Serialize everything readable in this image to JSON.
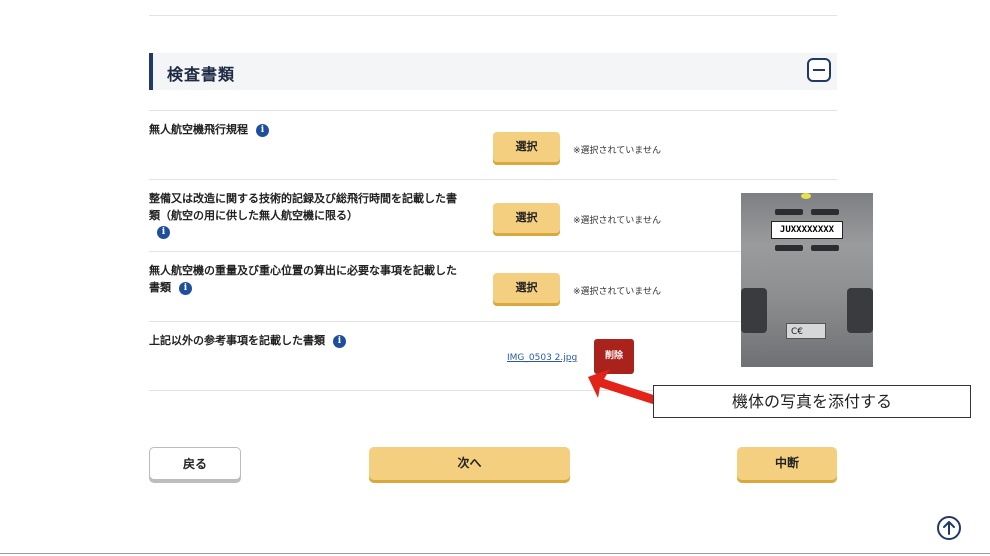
{
  "section": {
    "title": "検査書類",
    "collapse_icon": "minus-square-icon"
  },
  "rows": [
    {
      "label": "無人航空機飛行規程",
      "button_label": "選択",
      "status": "※選択されていません"
    },
    {
      "label": "整備又は改造に関する技術的記録及び総飛行時間を記載した書類（航空の用に供した無人航空機に限る）",
      "button_label": "選択",
      "status": "※選択されていません"
    },
    {
      "label": "無人航空機の重量及び重心位置の算出に必要な事項を記載した書類",
      "button_label": "選択",
      "status": "※選択されていません"
    },
    {
      "label": "上記以外の参考事項を記載した書類",
      "file_name": "IMG_0503 2.jpg",
      "delete_label": "削除"
    }
  ],
  "info_icon": {
    "glyph": "i",
    "name": "info-icon"
  },
  "photo": {
    "tag_text": "JUXXXXXXXX",
    "ce_text": "C€"
  },
  "callout": {
    "text": "機体の写真を添付する",
    "arrow_color": "#e2231a"
  },
  "footer": {
    "back_label": "戻る",
    "next_label": "次へ",
    "suspend_label": "中断"
  },
  "colors": {
    "accent_button": "#f5cf80",
    "delete_button": "#a9231c",
    "header_bar": "#1f3a66",
    "info_icon": "#1f4f9c"
  }
}
